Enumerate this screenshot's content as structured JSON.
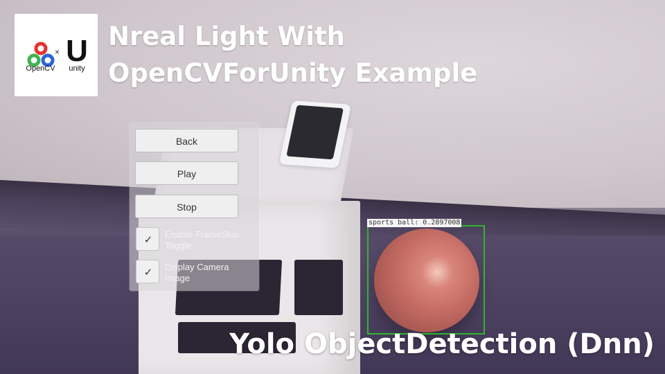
{
  "header": {
    "title_line1": "Nreal Light With",
    "title_line2": "OpenCVForUnity Example"
  },
  "logo": {
    "left_text": "OpenCV",
    "separator": "×",
    "right_mark": "U",
    "right_text": "unity"
  },
  "panel": {
    "buttons": [
      {
        "label": "Back"
      },
      {
        "label": "Play"
      },
      {
        "label": "Stop"
      }
    ],
    "toggles": [
      {
        "label": "Enable FrameSkip Toggle",
        "checked": true
      },
      {
        "label": "Display Camera Image",
        "checked": true
      }
    ],
    "check_glyph": "✓"
  },
  "detection": {
    "label": "sports ball: 0.2897008",
    "box_color": "#2fb62c"
  },
  "footer": {
    "example_name": "Yolo ObjectDetection (Dnn)"
  }
}
